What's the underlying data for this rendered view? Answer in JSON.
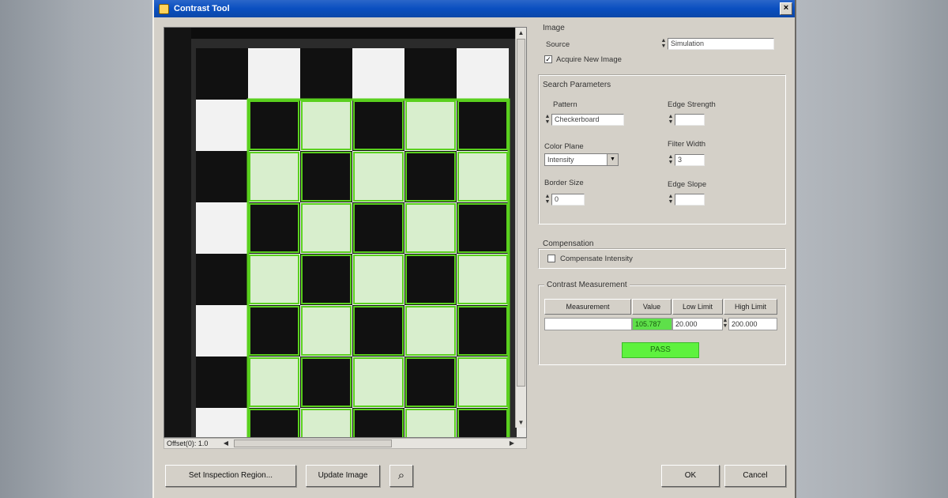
{
  "window": {
    "title": "Contrast Tool",
    "close_glyph": "×"
  },
  "viewer": {
    "zoom_label": "Offset(0): 1.0",
    "board": {
      "cols": 6,
      "rows": 8,
      "dark": "#111111",
      "light": "#f2f2f2",
      "highlight": "#5ad01e"
    }
  },
  "image_group": {
    "title": "Image",
    "source_label": "Source",
    "source_value": "Simulation",
    "acquire_checked": true,
    "acquire_label": "Acquire New Image"
  },
  "search_group": {
    "title": "Search Parameters",
    "pattern_label": "Pattern",
    "pattern_value": "Checkerboard",
    "edge_strength_label": "Edge Strength",
    "edge_strength_value": "",
    "color_plane_label": "Color Plane",
    "color_plane_value": "Intensity",
    "filter_width_label": "Filter Width",
    "filter_width_value": "3",
    "border_size_label": "Border Size",
    "border_size_value": "0",
    "edge_slope_label": "Edge Slope",
    "edge_slope_value": ""
  },
  "compensation_group": {
    "title": "Compensation",
    "compensate_checked": false,
    "compensate_label": "Compensate Intensity"
  },
  "contrast_group": {
    "title": "Contrast Measurement",
    "headers": [
      "Measurement",
      "Value",
      "Low Limit",
      "High Limit"
    ],
    "row": {
      "measurement": "",
      "value": "105.787",
      "low_limit": "20.000",
      "high_limit": "200.000"
    },
    "result": "PASS",
    "result_color": "#5ef23e"
  },
  "buttons": {
    "inspection_region": "Set Inspection Region...",
    "update_image": "Update Image",
    "zoom_icon": "magnifier-icon",
    "ok": "OK",
    "cancel": "Cancel"
  }
}
